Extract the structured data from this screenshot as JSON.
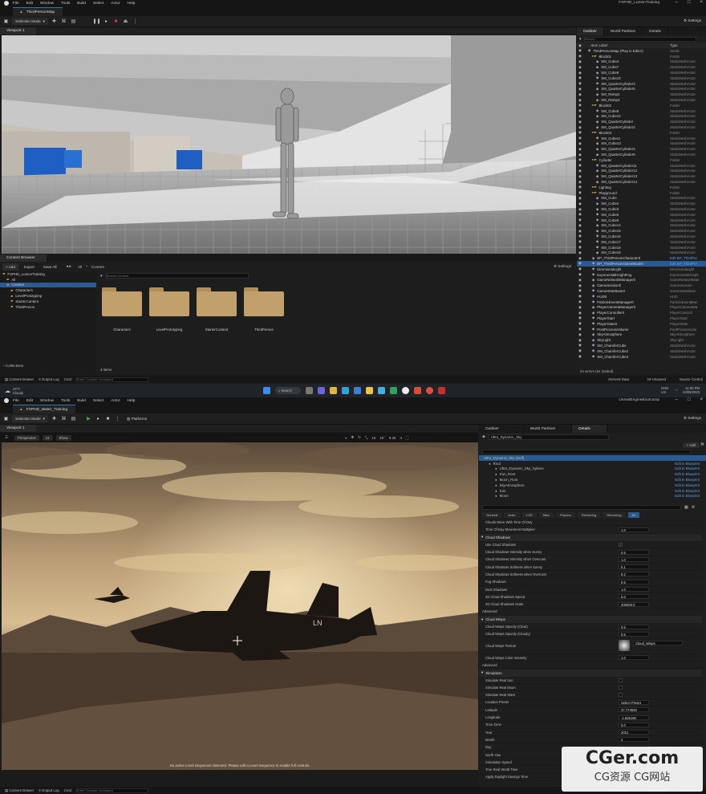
{
  "top": {
    "menu": [
      "File",
      "Edit",
      "Window",
      "Tools",
      "Build",
      "Select",
      "Actor",
      "Help"
    ],
    "app_title": "FXPHD_LumenTraining",
    "level_tab": "ThirdPersonMap",
    "mode": "Selection Mode",
    "settings": "Settings",
    "viewport_tab": "Viewport 1",
    "outliner": {
      "tabs": [
        "Outliner",
        "World Partition",
        "Details"
      ],
      "search_placeholder": "Search...",
      "col_label": "Item Label",
      "col_type": "Type",
      "items": [
        {
          "label": "ThirdPersonMap (Play in Editor)",
          "type": "World",
          "indent": 1
        },
        {
          "label": "Block01",
          "type": "Folder",
          "indent": 2
        },
        {
          "label": "SM_Cube4",
          "type": "StaticMeshActor",
          "indent": 3
        },
        {
          "label": "SM_Cube7",
          "type": "StaticMeshActor",
          "indent": 3
        },
        {
          "label": "SM_Cube9",
          "type": "StaticMeshActor",
          "indent": 3
        },
        {
          "label": "SM_Cube10",
          "type": "StaticMeshActor",
          "indent": 3
        },
        {
          "label": "SM_QuarterCylinder3",
          "type": "StaticMeshActor",
          "indent": 3
        },
        {
          "label": "SM_QuarterCylinder5",
          "type": "StaticMeshActor",
          "indent": 3
        },
        {
          "label": "SM_Ramp2",
          "type": "StaticMeshActor",
          "indent": 3
        },
        {
          "label": "SM_Ramp3",
          "type": "StaticMeshActor",
          "indent": 3
        },
        {
          "label": "Block02",
          "type": "Folder",
          "indent": 2
        },
        {
          "label": "SM_Cube8",
          "type": "StaticMeshActor",
          "indent": 3
        },
        {
          "label": "SM_Cube12",
          "type": "StaticMeshActor",
          "indent": 3
        },
        {
          "label": "SM_QuarterCylinder",
          "type": "StaticMeshActor",
          "indent": 3
        },
        {
          "label": "SM_QuarterCylinder2",
          "type": "StaticMeshActor",
          "indent": 3
        },
        {
          "label": "Block03",
          "type": "Folder",
          "indent": 2
        },
        {
          "label": "SM_Cube11",
          "type": "StaticMeshActor",
          "indent": 3
        },
        {
          "label": "SM_Cube13",
          "type": "StaticMeshActor",
          "indent": 3
        },
        {
          "label": "SM_QuarterCylinder4",
          "type": "StaticMeshActor",
          "indent": 3
        },
        {
          "label": "SM_QuarterCylinder5",
          "type": "StaticMeshActor",
          "indent": 3
        },
        {
          "label": "Cylinder",
          "type": "Folder",
          "indent": 2
        },
        {
          "label": "SM_QuarterCylinder11",
          "type": "StaticMeshActor",
          "indent": 3
        },
        {
          "label": "SM_QuarterCylinder12",
          "type": "StaticMeshActor",
          "indent": 3
        },
        {
          "label": "SM_QuarterCylinder13",
          "type": "StaticMeshActor",
          "indent": 3
        },
        {
          "label": "SM_QuarterCylinder14",
          "type": "StaticMeshActor",
          "indent": 3
        },
        {
          "label": "Lighting",
          "type": "Folder",
          "indent": 2
        },
        {
          "label": "Playground",
          "type": "Folder",
          "indent": 2
        },
        {
          "label": "SM_Cube",
          "type": "StaticMeshActor",
          "indent": 3
        },
        {
          "label": "SM_Cube2",
          "type": "StaticMeshActor",
          "indent": 3
        },
        {
          "label": "SM_Cube3",
          "type": "StaticMeshActor",
          "indent": 3
        },
        {
          "label": "SM_Cube5",
          "type": "StaticMeshActor",
          "indent": 3
        },
        {
          "label": "SM_Cube6",
          "type": "StaticMeshActor",
          "indent": 3
        },
        {
          "label": "SM_Cube14",
          "type": "StaticMeshActor",
          "indent": 3
        },
        {
          "label": "SM_Cube15",
          "type": "StaticMeshActor",
          "indent": 3
        },
        {
          "label": "SM_Cube16",
          "type": "StaticMeshActor",
          "indent": 3
        },
        {
          "label": "SM_Cube17",
          "type": "StaticMeshActor",
          "indent": 3
        },
        {
          "label": "SM_Cube18",
          "type": "StaticMeshActor",
          "indent": 3
        },
        {
          "label": "SM_Cube19",
          "type": "StaticMeshActor",
          "indent": 3
        },
        {
          "label": "BP_ThirdPersonCharacter0",
          "type": "Edit BP_ThirdPer",
          "indent": 2
        },
        {
          "label": "BP_ThirdPersonGameMode0",
          "type": "Edit BP_ThirdPer",
          "indent": 2,
          "selected": true
        },
        {
          "label": "DirectionalLight",
          "type": "DirectionalLight",
          "indent": 2
        },
        {
          "label": "ExponentialHeightFog",
          "type": "ExponentialHeight",
          "indent": 2
        },
        {
          "label": "GameNetworkManager0",
          "type": "GameNetworkMan",
          "indent": 2
        },
        {
          "label": "GameSession0",
          "type": "GameSession",
          "indent": 2
        },
        {
          "label": "GameStateBase0",
          "type": "GameStateBase",
          "indent": 2
        },
        {
          "label": "HUD0",
          "type": "HUD",
          "indent": 2
        },
        {
          "label": "ParticleEventManager0",
          "type": "ParticleEventMan",
          "indent": 2
        },
        {
          "label": "PlayerCameraManager0",
          "type": "PlayerCameraMa",
          "indent": 2
        },
        {
          "label": "PlayerController0",
          "type": "PlayerControll",
          "indent": 2
        },
        {
          "label": "PlayerStart",
          "type": "PlayerStart",
          "indent": 2
        },
        {
          "label": "PlayerState0",
          "type": "PlayerState",
          "indent": 2
        },
        {
          "label": "PostProcessVolume",
          "type": "PostProcessVolu",
          "indent": 2
        },
        {
          "label": "SkyAtmosphere",
          "type": "SkyAtmosphere",
          "indent": 2
        },
        {
          "label": "SkyLight",
          "type": "SkyLight",
          "indent": 2
        },
        {
          "label": "SM_ChamferCube",
          "type": "StaticMeshActor",
          "indent": 2
        },
        {
          "label": "SM_ChamferCube2",
          "type": "StaticMeshActor",
          "indent": 2
        },
        {
          "label": "SM_ChamferCube3",
          "type": "StaticMeshActor",
          "indent": 2
        }
      ],
      "footer": "54 actors (54 loaded)"
    },
    "content_browser": {
      "tab": "Content Browser",
      "add": "+ Add",
      "import": "Import",
      "save_all": "Save All",
      "path_all": "All",
      "path_content": "Content",
      "settings": "Settings",
      "search_placeholder": "Search Content",
      "tree": [
        {
          "label": "FXPHD_LumenTraining",
          "indent": 0
        },
        {
          "label": "All",
          "indent": 1
        },
        {
          "label": "Content",
          "indent": 1,
          "selected": true
        },
        {
          "label": "Characters",
          "indent": 2
        },
        {
          "label": "LevelPrototyping",
          "indent": 2
        },
        {
          "label": "StarterContent",
          "indent": 2
        },
        {
          "label": "ThirdPerson",
          "indent": 2
        }
      ],
      "folders": [
        "Characters",
        "LevelPrototyping",
        "StarterContent",
        "ThirdPerson"
      ],
      "item_count": "4 items",
      "collections": "Collections"
    },
    "status": {
      "content_drawer": "Content Drawer",
      "output_log": "Output Log",
      "cmd": "Cmd",
      "cmd_placeholder": "Enter Console Command",
      "derived": "Derived Data",
      "unsaved": "19 Unsaved",
      "source": "Source Control"
    }
  },
  "taskbar": {
    "weather_temp": "24°C",
    "weather_desc": "Cloudy",
    "search": "Search",
    "lang": "ENG\nUS",
    "time": "11:06 PM",
    "date": "23/09/2023"
  },
  "bottom": {
    "menu": [
      "File",
      "Edit",
      "Window",
      "Tools",
      "Build",
      "Select",
      "Actor",
      "Help"
    ],
    "app_title": "UnrealEngineBootcamp",
    "level_tab": "FXPHD_Water_Training",
    "mode": "Selection Mode",
    "platforms": "Platforms",
    "settings": "Settings",
    "viewport_tab": "Viewport 1",
    "vp_perspective": "Perspective",
    "vp_lit": "Lit",
    "vp_show": "Show",
    "vp_nums": [
      "10",
      "10°",
      "0.25",
      "4"
    ],
    "vp_msg": "No active Level Sequencer detected. Please edit a Level Sequence to enable full controls.",
    "tabs": [
      "Outliner",
      "World Partition",
      "Details"
    ],
    "actor_name": "Ultra_Dynamic_Sky",
    "add": "+ Add",
    "self_label": "Ultra_Dynamic_Sky (Self)",
    "components": [
      {
        "label": "Root",
        "indent": 1
      },
      {
        "label": "Ultra_Dynamic_Sky_Sphere",
        "indent": 2
      },
      {
        "label": "Sun_Root",
        "indent": 2
      },
      {
        "label": "Moon_Root",
        "indent": 2
      },
      {
        "label": "SkyAtmosphere",
        "indent": 2
      },
      {
        "label": "Sun",
        "indent": 2
      },
      {
        "label": "Moon",
        "indent": 2
      }
    ],
    "edit_bp": "Edit in Blueprint",
    "filter_tabs": [
      "General",
      "Actor",
      "LOD",
      "Misc",
      "Physics",
      "Rendering",
      "Streaming",
      "All"
    ],
    "rows": [
      {
        "t": "row",
        "k": "Clouds Move With Time Of Day",
        "v": ""
      },
      {
        "t": "row",
        "k": "Time Of Day Movement Multiplier",
        "v": "1.0"
      },
      {
        "t": "sec",
        "k": "Cloud Shadows"
      },
      {
        "t": "row",
        "k": "Use Cloud Shadows",
        "cb": "on"
      },
      {
        "t": "row",
        "k": "Cloud Shadows Intensity when Sunny",
        "v": "0.5"
      },
      {
        "t": "row",
        "k": "Cloud Shadows Intensity when Overcast",
        "v": "1.0"
      },
      {
        "t": "row",
        "k": "Cloud Shadows Softness when Sunny",
        "v": "0.1"
      },
      {
        "t": "row",
        "k": "Cloud Shadows Softness when Overcast",
        "v": "0.2"
      },
      {
        "t": "row",
        "k": "Fog Shadows",
        "v": "0.6"
      },
      {
        "t": "row",
        "k": "Dust Shadows",
        "v": "1.0"
      },
      {
        "t": "row",
        "k": "2D Cloud Shadows Speed",
        "v": "5.0"
      },
      {
        "t": "row",
        "k": "2D Cloud Shadows Scale",
        "v": "400000.0"
      },
      {
        "t": "sub",
        "k": "Advanced"
      },
      {
        "t": "sec",
        "k": "Cloud Wisps"
      },
      {
        "t": "row",
        "k": "Cloud Wisps Opacity (Clear)",
        "v": "0.5"
      },
      {
        "t": "row",
        "k": "Cloud Wisps Opacity (Cloudy)",
        "v": "0.5"
      },
      {
        "t": "tex",
        "k": "Cloud Wisps Texture",
        "v": "Cloud_Wisps"
      },
      {
        "t": "row",
        "k": "Cloud Wisps Color Intensity",
        "v": "1.0"
      },
      {
        "t": "sub",
        "k": "Advanced"
      },
      {
        "t": "sec",
        "k": "Simulation"
      },
      {
        "t": "row",
        "k": "Simulate Real Sun",
        "cb": "off"
      },
      {
        "t": "row",
        "k": "Simulate Real Moon",
        "cb": "off"
      },
      {
        "t": "row",
        "k": "Simulate Real Stars",
        "cb": "off"
      },
      {
        "t": "row",
        "k": "Location Preset",
        "v": "Select Preset"
      },
      {
        "t": "row",
        "k": "Latitude",
        "v": "37.774930"
      },
      {
        "t": "row",
        "k": "Longitude",
        "v": "-1.826190"
      },
      {
        "t": "row",
        "k": "Time Zone",
        "v": "0.0"
      },
      {
        "t": "row",
        "k": "Year",
        "v": "2021"
      },
      {
        "t": "row",
        "k": "Month",
        "v": "3"
      },
      {
        "t": "row",
        "k": "Day",
        "v": "20"
      },
      {
        "t": "row",
        "k": "North Yaw",
        "v": ""
      },
      {
        "t": "row",
        "k": "Simulation Speed",
        "v": ""
      },
      {
        "t": "row",
        "k": "True Real World Time",
        "v": ""
      },
      {
        "t": "row",
        "k": "Apply Daylight Savings Time",
        "v": ""
      }
    ],
    "status": {
      "content_drawer": "Content Drawer",
      "output_log": "Output Log",
      "cmd": "Cmd",
      "cmd_placeholder": "Enter Console Command",
      "derived": "Derived Data",
      "unsaved": "19 Unsaved",
      "source": "Source Control"
    }
  },
  "watermark": {
    "main": "CGer.com",
    "sub": "CG资源 CG网站"
  },
  "colors": {
    "accent": "#2a5a90",
    "folder": "#c2a06b",
    "bp_link": "#5aa0e8",
    "play": "#3fb24f"
  }
}
